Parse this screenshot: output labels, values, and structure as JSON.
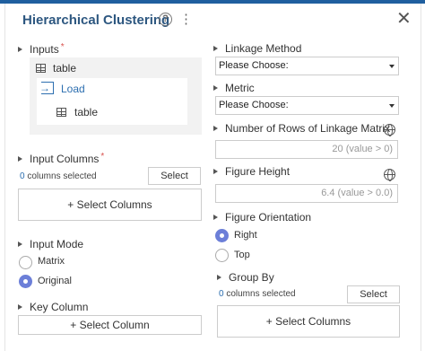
{
  "header": {
    "title": "Hierarchical Clustering",
    "help_icon": "question-circle-icon",
    "menu_icon": "vertical-ellipsis-icon",
    "close_icon": "close-icon"
  },
  "left": {
    "inputs": {
      "label": "Inputs",
      "required_mark": "*",
      "source_table": "table",
      "load_label": "Load",
      "load_table": "table"
    },
    "input_columns": {
      "label": "Input Columns",
      "required_mark": "*",
      "count": "0",
      "selected_text": " columns selected",
      "select_button": "Select",
      "select_columns_button": "+ Select Columns"
    },
    "input_mode": {
      "label": "Input Mode",
      "options": [
        "Matrix",
        "Original"
      ],
      "selected": "Original"
    },
    "key_column": {
      "label": "Key Column",
      "select_button": "+ Select Column"
    }
  },
  "right": {
    "linkage_method": {
      "label": "Linkage Method",
      "value": "Please Choose:"
    },
    "metric": {
      "label": "Metric",
      "value": "Please Choose:"
    },
    "num_rows": {
      "label": "Number of Rows of Linkage Matrix",
      "placeholder": "20 (value > 0)"
    },
    "figure_height": {
      "label": "Figure Height",
      "placeholder": "6.4 (value > 0.0)"
    },
    "figure_orientation": {
      "label": "Figure Orientation",
      "options": [
        "Right",
        "Top"
      ],
      "selected": "Right"
    },
    "group_by": {
      "label": "Group By",
      "count": "0",
      "selected_text": " columns selected",
      "select_button": "Select",
      "select_columns_button": "+ Select Columns"
    }
  },
  "colors": {
    "accent": "#1f5f9f",
    "title": "#2d5780",
    "radio_selected": "#6c7fd8",
    "required": "#d9534f",
    "link": "#2d6fb0"
  }
}
